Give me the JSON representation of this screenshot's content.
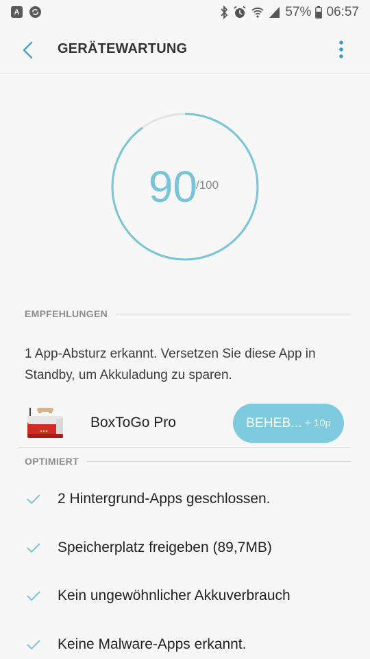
{
  "status_bar": {
    "left_icons": [
      {
        "name": "a-notification-icon",
        "glyph": "A"
      },
      {
        "name": "sync-notification-icon",
        "glyph": "S"
      }
    ],
    "battery": "57%",
    "time": "06:57"
  },
  "header": {
    "title": "GERÄTEWARTUNG"
  },
  "score": {
    "value": "90",
    "max": "/100",
    "fraction": 0.9,
    "color": "#78c4d9"
  },
  "recommendations": {
    "section_label": "EMPFEHLUNGEN",
    "message": "1 App-Absturz erkannt. Versetzen Sie diese App in Standby, um Akkuladung zu sparen.",
    "app": {
      "name": "BoxToGo Pro",
      "fix_label": "BEHEB...",
      "fix_points": "+ 10p"
    }
  },
  "optimized": {
    "section_label": "OPTIMIERT",
    "items": [
      "2 Hintergrund-Apps geschlossen.",
      "Speicherplatz freigeben (89,7MB)",
      "Kein ungewöhnlicher Akkuverbrauch",
      "Keine Malware-Apps erkannt."
    ]
  },
  "colors": {
    "accent": "#78c4d9",
    "button": "#7ecbe0",
    "background": "#f7f7f7"
  }
}
